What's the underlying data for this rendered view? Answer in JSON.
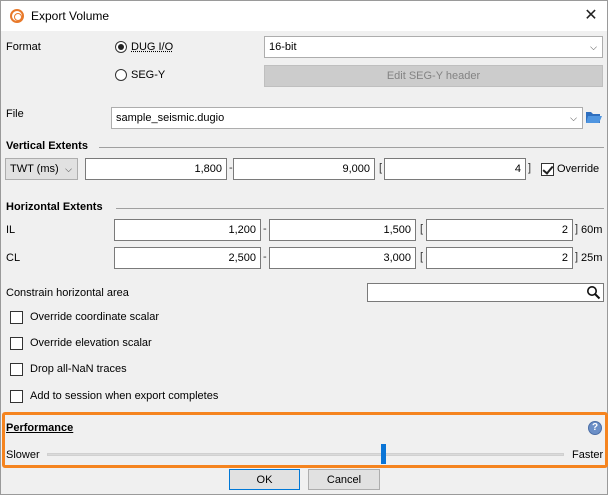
{
  "window": {
    "title": "Export Volume",
    "close_glyph": "✕"
  },
  "format": {
    "label": "Format",
    "options": [
      "DUG I/O",
      "SEG-Y"
    ],
    "selected": "DUG I/O",
    "bit_depth": "16-bit",
    "edit_segy_label": "Edit SEG-Y header"
  },
  "file": {
    "label": "File",
    "value": "sample_seismic.dugio"
  },
  "vertical": {
    "title": "Vertical Extents",
    "unit": "TWT (ms)",
    "start": "1,800",
    "end": "9,000",
    "step": "4",
    "override_label": "Override",
    "override_checked": true
  },
  "horizontal": {
    "title": "Horizontal Extents",
    "rows": [
      {
        "label": "IL",
        "start": "1,200",
        "end": "1,500",
        "step": "2",
        "spacing": "60m"
      },
      {
        "label": "CL",
        "start": "2,500",
        "end": "3,000",
        "step": "2",
        "spacing": "25m"
      }
    ]
  },
  "constrain": {
    "label": "Constrain horizontal area",
    "value": ""
  },
  "checkboxes": [
    {
      "label": "Override coordinate scalar",
      "checked": false
    },
    {
      "label": "Override elevation scalar",
      "checked": false
    },
    {
      "label": "Drop all-NaN traces",
      "checked": false
    },
    {
      "label": "Add to session when export completes",
      "checked": false
    }
  ],
  "performance": {
    "title": "Performance",
    "slower": "Slower",
    "faster": "Faster",
    "level_fraction": 0.65
  },
  "buttons": {
    "ok": "OK",
    "cancel": "Cancel"
  },
  "glyphs": {
    "dash": "-",
    "bracket_open": "[",
    "bracket_close": "]",
    "chevron": "⌵",
    "help": "?"
  },
  "colors": {
    "highlight": "#f5841f",
    "slider_thumb": "#0a74d6",
    "app_icon": "#e8792a"
  }
}
